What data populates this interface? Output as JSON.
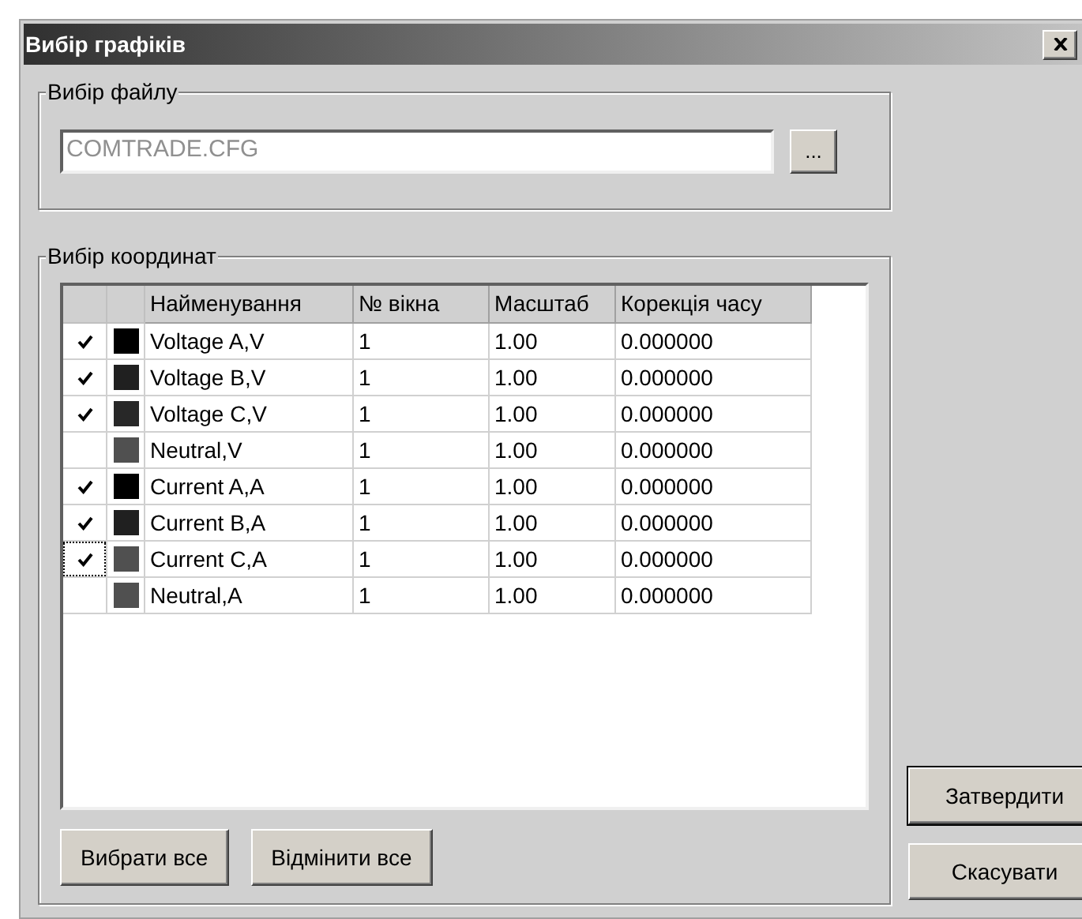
{
  "window": {
    "title": "Вибір графіків"
  },
  "file_group": {
    "title": "Вибір файлу",
    "field": {
      "value": "COMTRADE.CFG"
    },
    "browse_button": "..."
  },
  "coords_group": {
    "title": "Вибір координат",
    "table": {
      "columns": [
        "Найменування",
        "№ вікна",
        "Масштаб",
        "Корекція часу"
      ],
      "rows": [
        {
          "checked": true,
          "focused": false,
          "color": "#000000",
          "name": "Voltage A,V",
          "window": "1",
          "scale": "1.00",
          "correction": "0.000000"
        },
        {
          "checked": true,
          "focused": false,
          "color": "#202020",
          "name": "Voltage B,V",
          "window": "1",
          "scale": "1.00",
          "correction": "0.000000"
        },
        {
          "checked": true,
          "focused": false,
          "color": "#282828",
          "name": "Voltage C,V",
          "window": "1",
          "scale": "1.00",
          "correction": "0.000000"
        },
        {
          "checked": false,
          "focused": false,
          "color": "#505050",
          "name": "Neutral,V",
          "window": "1",
          "scale": "1.00",
          "correction": "0.000000"
        },
        {
          "checked": true,
          "focused": false,
          "color": "#000000",
          "name": "Current A,A",
          "window": "1",
          "scale": "1.00",
          "correction": "0.000000"
        },
        {
          "checked": true,
          "focused": false,
          "color": "#202020",
          "name": "Current B,A",
          "window": "1",
          "scale": "1.00",
          "correction": "0.000000"
        },
        {
          "checked": true,
          "focused": true,
          "color": "#505050",
          "name": "Current C,A",
          "window": "1",
          "scale": "1.00",
          "correction": "0.000000"
        },
        {
          "checked": false,
          "focused": false,
          "color": "#505050",
          "name": "Neutral,A",
          "window": "1",
          "scale": "1.00",
          "correction": "0.000000"
        }
      ]
    },
    "buttons": [
      "Вибрати все",
      "Відмінити все"
    ]
  },
  "dialog_buttons": [
    {
      "label": "Затвердити",
      "default": true
    },
    {
      "label": "Скасувати",
      "default": false
    }
  ]
}
